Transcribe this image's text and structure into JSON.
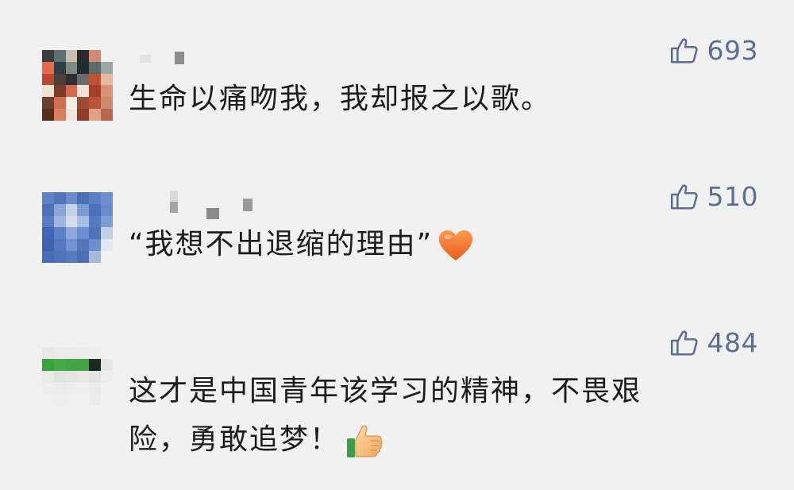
{
  "comments": [
    {
      "likes": "693",
      "text": "生命以痛吻我，我却报之以歌。",
      "emoji": ""
    },
    {
      "likes": "510",
      "text": "“我想不出退缩的理由”",
      "emoji": "orange-heart-icon"
    },
    {
      "likes": "484",
      "text": "这才是中国青年该学习的精神，不畏艰险，勇敢追梦！",
      "emoji": "thumbs-up-icon"
    }
  ],
  "colors": {
    "background": "#f1f1f1",
    "like_color": "#5a6f96",
    "text_color": "#1c1c1c"
  }
}
